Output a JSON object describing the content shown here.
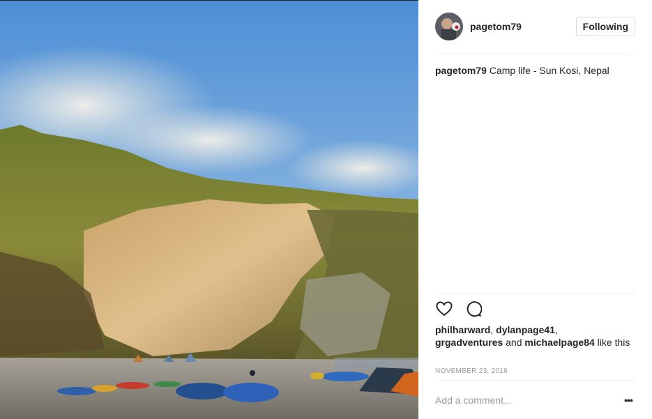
{
  "post": {
    "username": "pagetom79",
    "follow_label": "Following",
    "caption_user": "pagetom79",
    "caption_text": "Camp life - Sun Kosi, Nepal",
    "likes": {
      "user1": "philharward",
      "sep1": ", ",
      "user2": "dylanpage41",
      "sep2": ",",
      "user3": "grgadventures",
      "and": " and ",
      "user4": "michaelpage84",
      "suffix": " like this"
    },
    "date": "NOVEMBER 23, 2016",
    "comment_placeholder": "Add a comment...",
    "more_label": "•••"
  },
  "icons": {
    "like": "heart-icon",
    "comment": "comment-icon",
    "more": "more-options-icon"
  },
  "colors": {
    "text": "#262626",
    "muted": "#999999",
    "divider": "#efefef",
    "button_border": "#dbdbdb"
  }
}
